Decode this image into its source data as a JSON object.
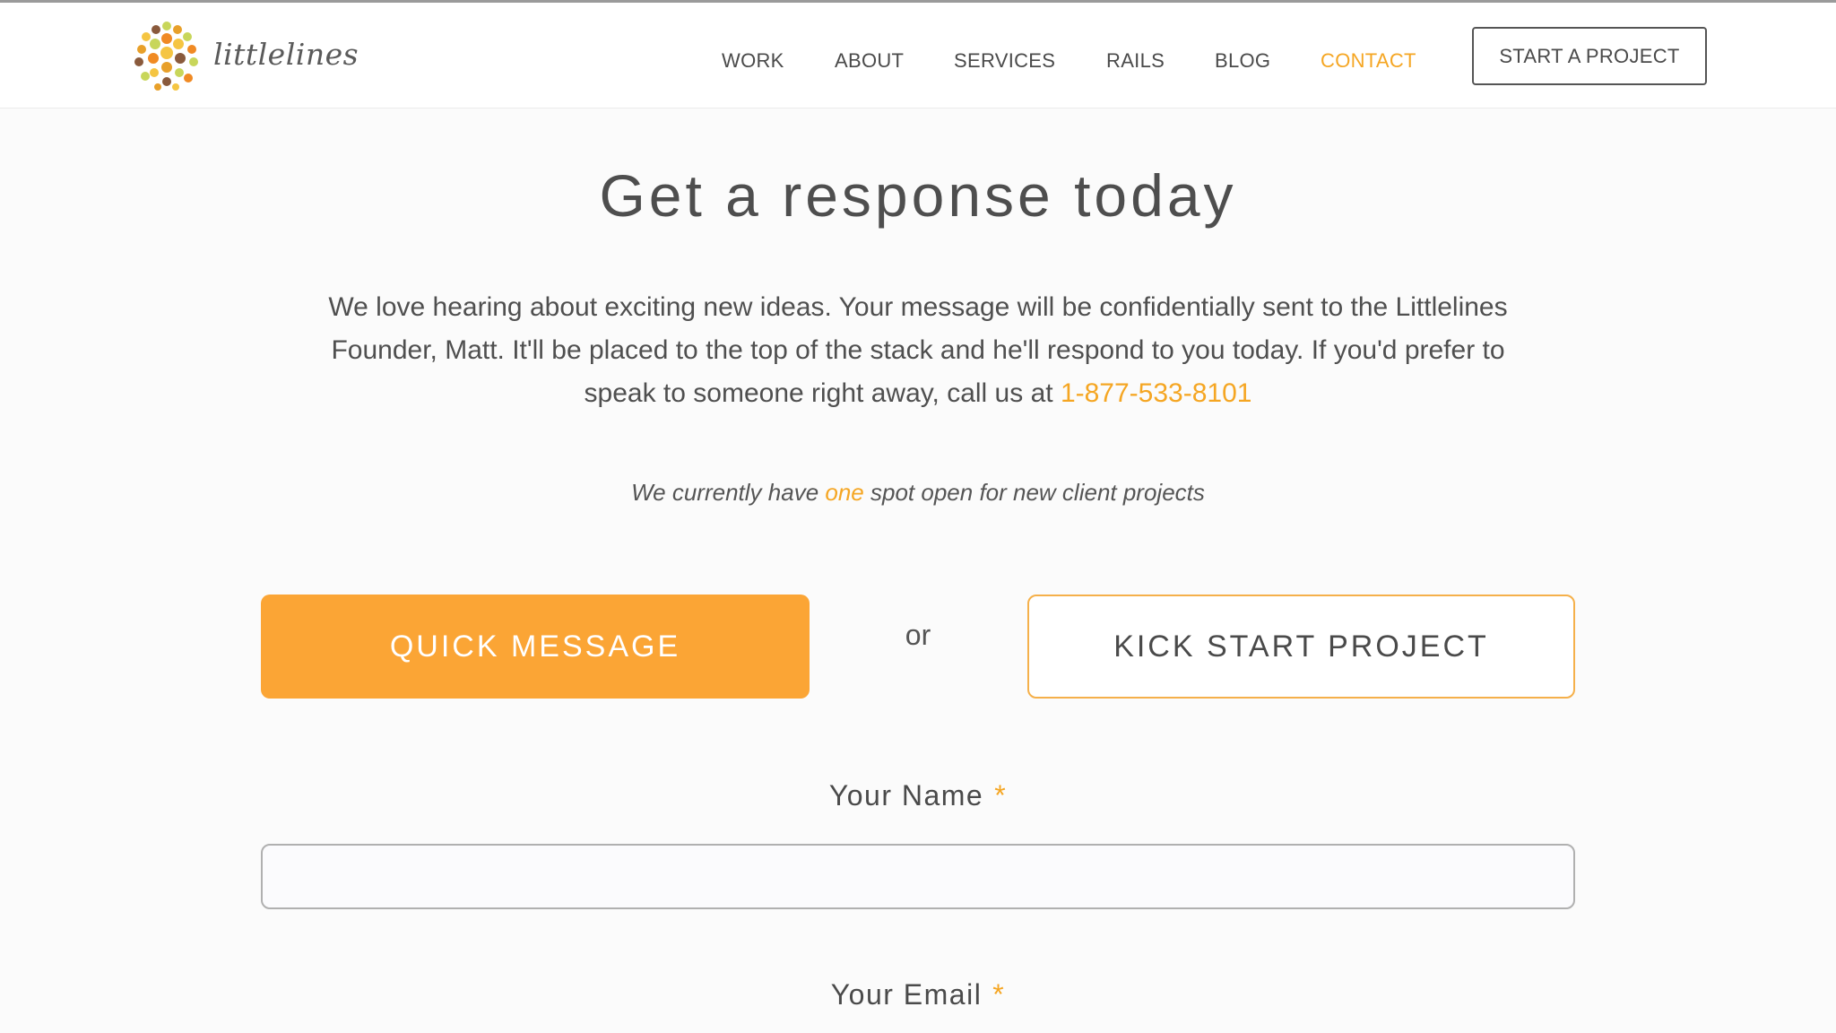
{
  "header": {
    "logo_text": "littlelines",
    "nav": [
      "WORK",
      "ABOUT",
      "SERVICES",
      "RAILS",
      "BLOG",
      "CONTACT"
    ],
    "active_nav": "CONTACT",
    "cta_label": "START A PROJECT"
  },
  "main": {
    "title": "Get a response today",
    "intro_text": "We love hearing about exciting new ideas. Your message will be confidentially sent to the Littlelines Founder, Matt. It'll be placed to the top of the stack and he'll respond to you today. If you'd prefer to speak to someone right away, call us at",
    "phone": "1-877-533-8101",
    "availability": {
      "prefix": "We currently have",
      "highlight": "one",
      "suffix": "spot open for new client projects"
    },
    "quick_message_label": "QUICK MESSAGE",
    "or_label": "or",
    "kick_start_label": "KICK START PROJECT"
  },
  "form": {
    "name_label": "Your Name",
    "name_value": "",
    "email_label": "Your Email",
    "required_marker": "*"
  },
  "colors": {
    "accent": "#f5a623",
    "button_fill": "#fba535",
    "text": "#4a4a4a"
  }
}
